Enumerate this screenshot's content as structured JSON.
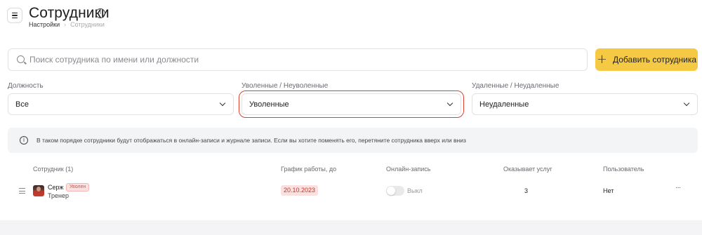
{
  "header": {
    "title": "Сотрудники",
    "info_icon": "i",
    "breadcrumb": [
      "Настройки",
      "Сотрудники"
    ]
  },
  "search": {
    "placeholder": "Поиск сотрудника по имени или должности",
    "value": ""
  },
  "add_button": {
    "plus": "+",
    "label": "Добавить сотрудника"
  },
  "filters": {
    "position": {
      "label": "Должность",
      "value": "Все"
    },
    "fired": {
      "label": "Уволенные / Неуволенные",
      "value": "Уволенные"
    },
    "deleted": {
      "label": "Удаленные / Неудаленные",
      "value": "Неудаленные"
    }
  },
  "notice": {
    "icon": "i",
    "text": "В таком порядке сотрудники будут отображаться в онлайн-записи и журнале записи. Если вы хотите поменять его, перетяните сотрудника вверх или вниз"
  },
  "table": {
    "headers": [
      "Сотрудник (1)",
      "График работы, до",
      "Онлайн-запись",
      "Оказывает услуг",
      "Пользователь"
    ],
    "rows": [
      {
        "name": "Серж",
        "badge": "Уволен",
        "role": "Тренер",
        "schedule_until": "20.10.2023",
        "online_label": "Выкл",
        "services": "3",
        "user": "Нет",
        "more": "···"
      }
    ]
  },
  "colors": {
    "accent": "#f6c944",
    "highlight": "#e0412e",
    "badge_bg": "#fbe0e0",
    "badge_text": "#d9534f"
  }
}
